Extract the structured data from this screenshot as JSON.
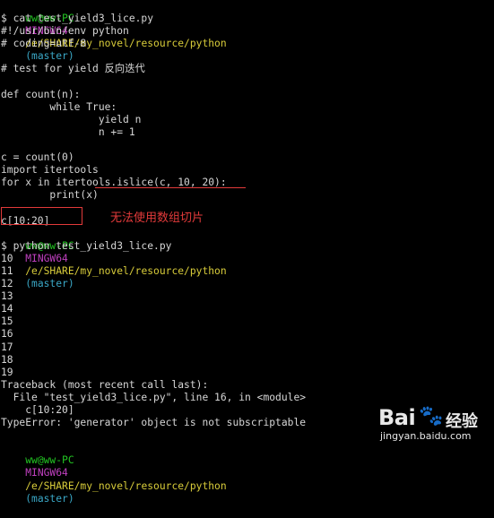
{
  "terminal": {
    "prompt1": {
      "user": "ww@ww-PC",
      "host": "MINGW64",
      "path": "/e/SHARE/my_novel/resource/python",
      "branch": "(master)"
    },
    "lines_block1": [
      "$ cat test_yield3_lice.py",
      "#!/usr/bin/env python",
      "# coding=utf-8",
      "",
      "# test for yield 反向迭代",
      "",
      "def count(n):",
      "        while True:",
      "                yield n",
      "                n += 1",
      "",
      "c = count(0)",
      "import itertools",
      "for x in itertools.islice(c, 10, 20):",
      "        print(x)",
      "",
      "c[10:20]"
    ],
    "prompt2": {
      "user": "ww@ww-PC",
      "host": "MINGW64",
      "path": "/e/SHARE/my_novel/resource/python",
      "branch": "(master)"
    },
    "lines_block2": [
      "$ python test_yield3_lice.py",
      "10",
      "11",
      "12",
      "13",
      "14",
      "15",
      "16",
      "17",
      "18",
      "19",
      "Traceback (most recent call last):",
      "  File \"test_yield3_lice.py\", line 16, in <module>",
      "    c[10:20]",
      "TypeError: 'generator' object is not subscriptable",
      ""
    ],
    "prompt3": {
      "user": "ww@ww-PC",
      "host": "MINGW64",
      "path": "/e/SHARE/my_novel/resource/python",
      "branch": "(master)"
    }
  },
  "annotation": {
    "note": "无法使用数组切片"
  },
  "watermark": {
    "logo_text": "Bai",
    "paw_glyph": "🐾",
    "brand_text": "经验",
    "url": "jingyan.baidu.com"
  },
  "colors": {
    "background": "#000000",
    "text": "#d7d7d7",
    "prompt_user": "#22c322",
    "prompt_host": "#c040c0",
    "prompt_path": "#d8cc3a",
    "prompt_branch": "#3aa7c6",
    "annotation": "#e23a3a"
  }
}
